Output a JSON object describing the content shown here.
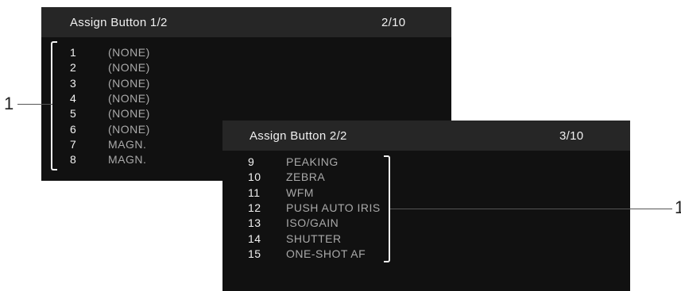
{
  "screen1": {
    "title": "Assign Button 1/2",
    "page": "2/10",
    "items": [
      {
        "num": "1",
        "value": "(NONE)"
      },
      {
        "num": "2",
        "value": "(NONE)"
      },
      {
        "num": "3",
        "value": "(NONE)"
      },
      {
        "num": "4",
        "value": "(NONE)"
      },
      {
        "num": "5",
        "value": "(NONE)"
      },
      {
        "num": "6",
        "value": "(NONE)"
      },
      {
        "num": "7",
        "value": "MAGN."
      },
      {
        "num": "8",
        "value": "MAGN."
      }
    ]
  },
  "screen2": {
    "title": "Assign Button 2/2",
    "page": "3/10",
    "items": [
      {
        "num": "9",
        "value": "PEAKING"
      },
      {
        "num": "10",
        "value": "ZEBRA"
      },
      {
        "num": "11",
        "value": "WFM"
      },
      {
        "num": "12",
        "value": "PUSH AUTO IRIS"
      },
      {
        "num": "13",
        "value": "ISO/GAIN"
      },
      {
        "num": "14",
        "value": "SHUTTER"
      },
      {
        "num": "15",
        "value": "ONE-SHOT AF"
      }
    ]
  },
  "callouts": {
    "left": "1",
    "right": "1"
  }
}
